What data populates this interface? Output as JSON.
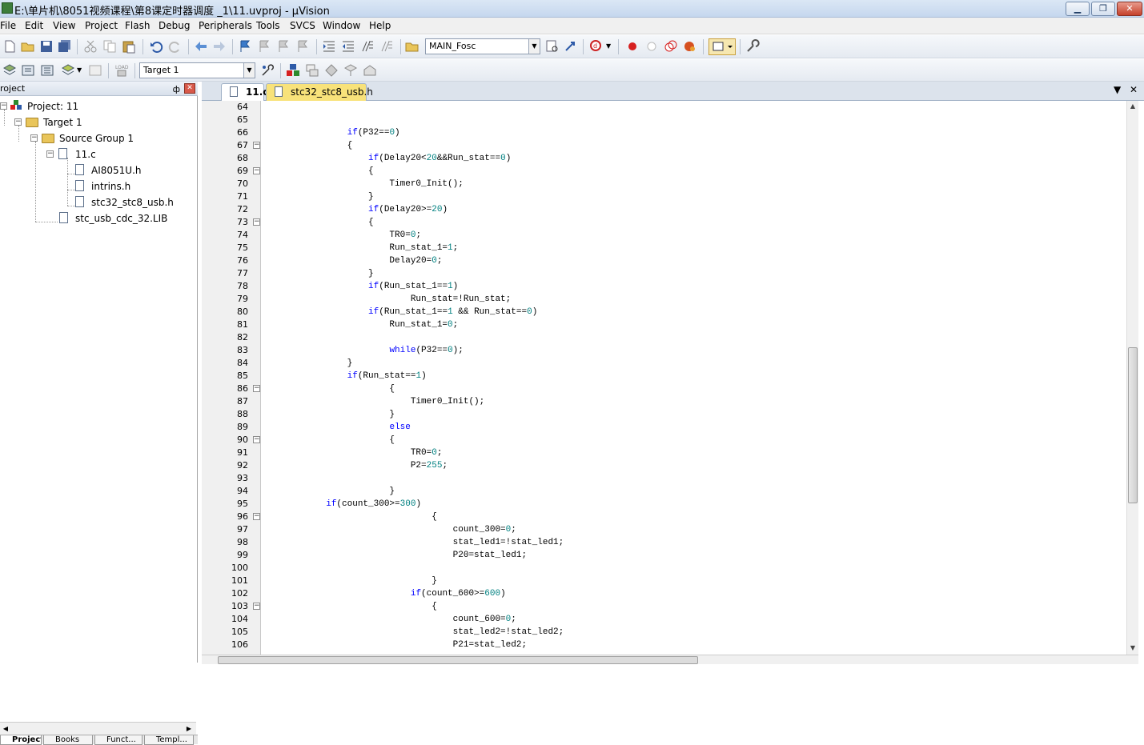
{
  "window": {
    "title": "E:\\单片机\\8051视频课程\\第8课定时器调度 _1\\11.uvproj - µVision"
  },
  "menu": [
    "File",
    "Edit",
    "View",
    "Project",
    "Flash",
    "Debug",
    "Peripherals",
    "Tools",
    "SVCS",
    "Window",
    "Help"
  ],
  "toolbar": {
    "function_combo": "MAIN_Fosc",
    "target_combo": "Target 1"
  },
  "project_pane": {
    "title": "roject",
    "pin": "ф",
    "tree": [
      {
        "label": "Project: 11"
      },
      {
        "label": "Target 1"
      },
      {
        "label": "Source Group 1"
      },
      {
        "label": "11.c"
      },
      {
        "label": "AI8051U.h"
      },
      {
        "label": "intrins.h"
      },
      {
        "label": "stc32_stc8_usb.h"
      },
      {
        "label": "stc_usb_cdc_32.LIB"
      }
    ],
    "tabs": [
      "Project",
      "Books",
      "Funct...",
      "Templ..."
    ]
  },
  "editor": {
    "tabs": [
      {
        "label": "11.c",
        "active": true
      },
      {
        "label": "stc32_stc8_usb.h",
        "active": false
      }
    ],
    "lines": [
      {
        "n": "64",
        "fold": false,
        "html": ""
      },
      {
        "n": "65",
        "fold": false,
        "html": ""
      },
      {
        "n": "66",
        "fold": false,
        "html": "                <span class=\"kw\">if</span>(P32==<span class=\"num\">0</span>)"
      },
      {
        "n": "67",
        "fold": true,
        "html": "                {"
      },
      {
        "n": "68",
        "fold": false,
        "html": "                    <span class=\"kw\">if</span>(Delay20&lt;<span class=\"num\">20</span>&amp;&amp;Run_stat==<span class=\"num\">0</span>)"
      },
      {
        "n": "69",
        "fold": true,
        "html": "                    {"
      },
      {
        "n": "70",
        "fold": false,
        "html": "                        Timer0_Init();"
      },
      {
        "n": "71",
        "fold": false,
        "html": "                    }"
      },
      {
        "n": "72",
        "fold": false,
        "html": "                    <span class=\"kw\">if</span>(Delay20&gt;=<span class=\"num\">20</span>)"
      },
      {
        "n": "73",
        "fold": true,
        "html": "                    {"
      },
      {
        "n": "74",
        "fold": false,
        "html": "                        TR0=<span class=\"num\">0</span>;"
      },
      {
        "n": "75",
        "fold": false,
        "html": "                        Run_stat_1=<span class=\"num\">1</span>;"
      },
      {
        "n": "76",
        "fold": false,
        "html": "                        Delay20=<span class=\"num\">0</span>;"
      },
      {
        "n": "77",
        "fold": false,
        "html": "                    }"
      },
      {
        "n": "78",
        "fold": false,
        "html": "                    <span class=\"kw\">if</span>(Run_stat_1==<span class=\"num\">1</span>)"
      },
      {
        "n": "79",
        "fold": false,
        "html": "                            Run_stat=!Run_stat;"
      },
      {
        "n": "80",
        "fold": false,
        "html": "                    <span class=\"kw\">if</span>(Run_stat_1==<span class=\"num\">1</span> &amp;&amp; Run_stat==<span class=\"num\">0</span>)"
      },
      {
        "n": "81",
        "fold": false,
        "html": "                        Run_stat_1=<span class=\"num\">0</span>;"
      },
      {
        "n": "82",
        "fold": false,
        "html": ""
      },
      {
        "n": "83",
        "fold": false,
        "html": "                        <span class=\"kw\">while</span>(P32==<span class=\"num\">0</span>);"
      },
      {
        "n": "84",
        "fold": false,
        "html": "                }"
      },
      {
        "n": "85",
        "fold": false,
        "html": "                <span class=\"kw\">if</span>(Run_stat==<span class=\"num\">1</span>)"
      },
      {
        "n": "86",
        "fold": true,
        "html": "                        {"
      },
      {
        "n": "87",
        "fold": false,
        "html": "                            Timer0_Init();"
      },
      {
        "n": "88",
        "fold": false,
        "html": "                        }"
      },
      {
        "n": "89",
        "fold": false,
        "html": "                        <span class=\"kw\">else</span>"
      },
      {
        "n": "90",
        "fold": true,
        "html": "                        {"
      },
      {
        "n": "91",
        "fold": false,
        "html": "                            TR0=<span class=\"num\">0</span>;"
      },
      {
        "n": "92",
        "fold": false,
        "html": "                            P2=<span class=\"num\">255</span>;"
      },
      {
        "n": "93",
        "fold": false,
        "html": ""
      },
      {
        "n": "94",
        "fold": false,
        "html": "                        }"
      },
      {
        "n": "95",
        "fold": false,
        "html": "            <span class=\"kw\">if</span>(count_300&gt;=<span class=\"num\">300</span>)"
      },
      {
        "n": "96",
        "fold": true,
        "html": "                                {"
      },
      {
        "n": "97",
        "fold": false,
        "html": "                                    count_300=<span class=\"num\">0</span>;"
      },
      {
        "n": "98",
        "fold": false,
        "html": "                                    stat_led1=!stat_led1;"
      },
      {
        "n": "99",
        "fold": false,
        "html": "                                    P20=stat_led1;"
      },
      {
        "n": "100",
        "fold": false,
        "html": ""
      },
      {
        "n": "101",
        "fold": false,
        "html": "                                }"
      },
      {
        "n": "102",
        "fold": false,
        "html": "                            <span class=\"kw\">if</span>(count_600&gt;=<span class=\"num\">600</span>)"
      },
      {
        "n": "103",
        "fold": true,
        "html": "                                {"
      },
      {
        "n": "104",
        "fold": false,
        "html": "                                    count_600=<span class=\"num\">0</span>;"
      },
      {
        "n": "105",
        "fold": false,
        "html": "                                    stat_led2=!stat_led2;"
      },
      {
        "n": "106",
        "fold": false,
        "html": "                                    P21=stat_led2;"
      }
    ]
  }
}
